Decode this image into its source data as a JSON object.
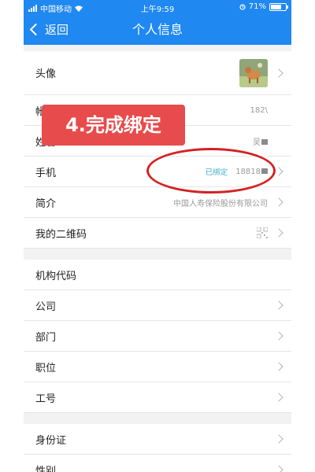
{
  "status_bar": {
    "carrier": "中国移动",
    "time": "上午9:59",
    "battery": "71%"
  },
  "nav": {
    "back_label": "返回",
    "title": "个人信息"
  },
  "groups": [
    {
      "rows": [
        {
          "label": "头像",
          "value": ""
        },
        {
          "label": "帐号",
          "value": "182\\"
        },
        {
          "label": "姓名",
          "value": "吴"
        },
        {
          "label": "手机",
          "status": "已绑定",
          "value": "18818"
        },
        {
          "label": "简介",
          "value": "中国人寿保险股份有限公司"
        },
        {
          "label": "我的二维码",
          "value": ""
        }
      ]
    },
    {
      "rows": [
        {
          "label": "机构代码",
          "value": ""
        },
        {
          "label": "公司",
          "value": ""
        },
        {
          "label": "部门",
          "value": ""
        },
        {
          "label": "职位",
          "value": ""
        },
        {
          "label": "工号",
          "value": ""
        }
      ]
    },
    {
      "rows": [
        {
          "label": "身份证",
          "value": ""
        },
        {
          "label": "性别",
          "value": ""
        }
      ]
    }
  ],
  "annotation": {
    "callout_text": "4.完成绑定"
  },
  "colors": {
    "nav_bg": "#1f88f1",
    "callout_bg": "#e84b4b",
    "ellipse": "#d32222",
    "bound_status": "#3fb1c8"
  },
  "icons": {
    "back": "chevron-left-icon",
    "row_arrow": "chevron-right-icon",
    "qr": "qr-code-icon"
  }
}
